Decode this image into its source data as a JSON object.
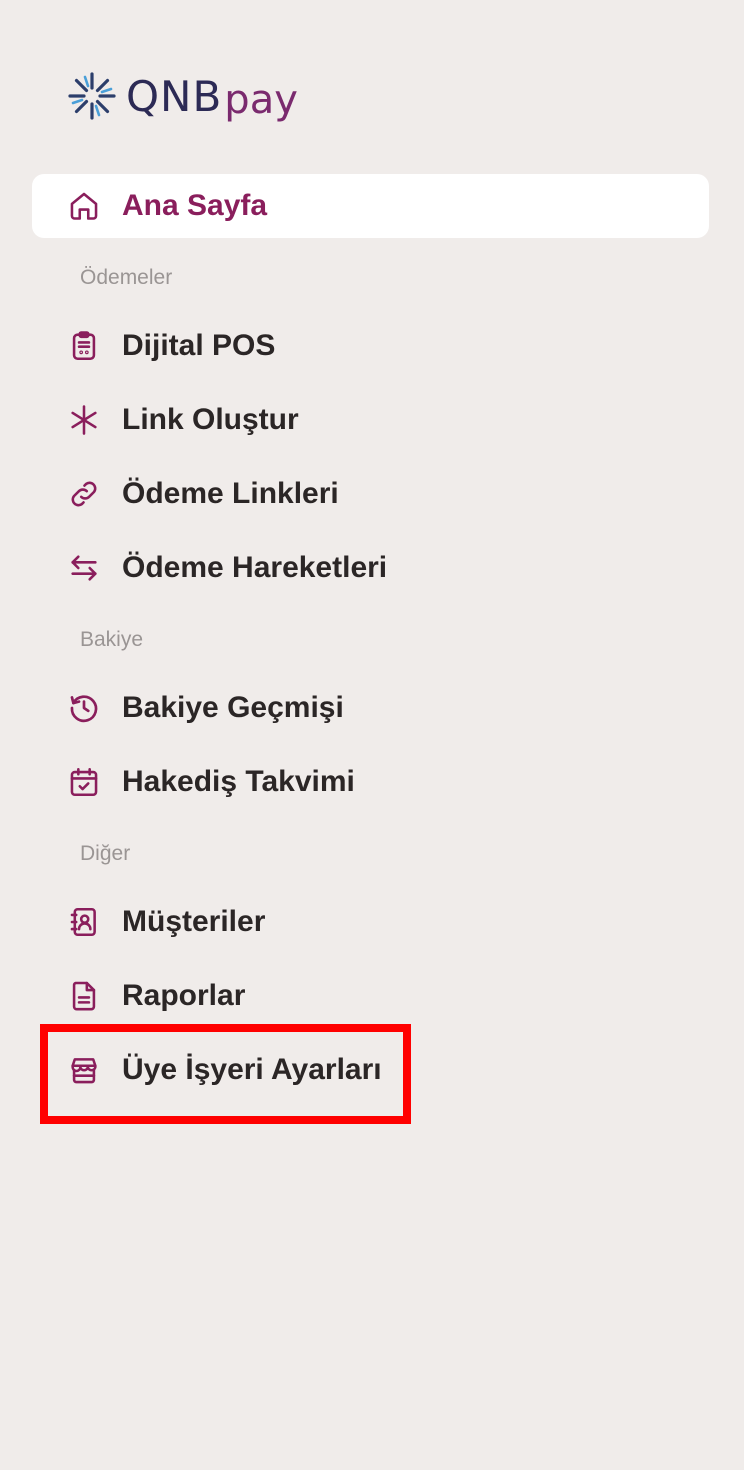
{
  "brand": {
    "logo_main": "QNB",
    "logo_sub": "pay"
  },
  "colors": {
    "accent": "#8a1e5c",
    "text": "#2b2626",
    "section": "#9a9594",
    "background": "#f0ecea",
    "highlight": "#ff0000"
  },
  "nav": {
    "home": {
      "label": "Ana Sayfa",
      "icon": "home-icon"
    },
    "section_payments": "Ödemeler",
    "digital_pos": {
      "label": "Dijital POS",
      "icon": "pos-terminal-icon"
    },
    "create_link": {
      "label": "Link Oluştur",
      "icon": "sparkle-icon"
    },
    "payment_links": {
      "label": "Ödeme Linkleri",
      "icon": "link-icon"
    },
    "payment_transactions": {
      "label": "Ödeme Hareketleri",
      "icon": "arrows-exchange-icon"
    },
    "section_balance": "Bakiye",
    "balance_history": {
      "label": "Bakiye Geçmişi",
      "icon": "history-icon"
    },
    "settlement_calendar": {
      "label": "Hakediş Takvimi",
      "icon": "calendar-check-icon"
    },
    "section_other": "Diğer",
    "customers": {
      "label": "Müşteriler",
      "icon": "contact-book-icon"
    },
    "reports": {
      "label": "Raporlar",
      "icon": "document-icon"
    },
    "merchant_settings": {
      "label": "Üye İşyeri Ayarları",
      "icon": "store-icon"
    }
  }
}
